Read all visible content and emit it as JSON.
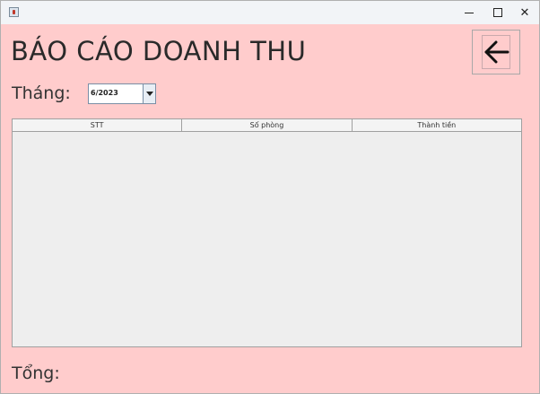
{
  "window": {
    "title": "",
    "controls": {
      "minimize_icon": "minimize-icon",
      "maximize_icon": "maximize-icon",
      "close_glyph": "✕"
    }
  },
  "header": {
    "title": "BÁO CÁO DOANH THU",
    "back_icon": "arrow-left-icon"
  },
  "filter": {
    "month_label": "Tháng:",
    "month_value": "6/2023"
  },
  "table": {
    "columns": [
      "STT",
      "Số phòng",
      "Thành tiền"
    ],
    "rows": []
  },
  "footer": {
    "total_label": "Tổng:"
  },
  "colors": {
    "background": "#ffcccc",
    "table_background": "#eeeeee",
    "titlebar": "#f2f4f7"
  }
}
